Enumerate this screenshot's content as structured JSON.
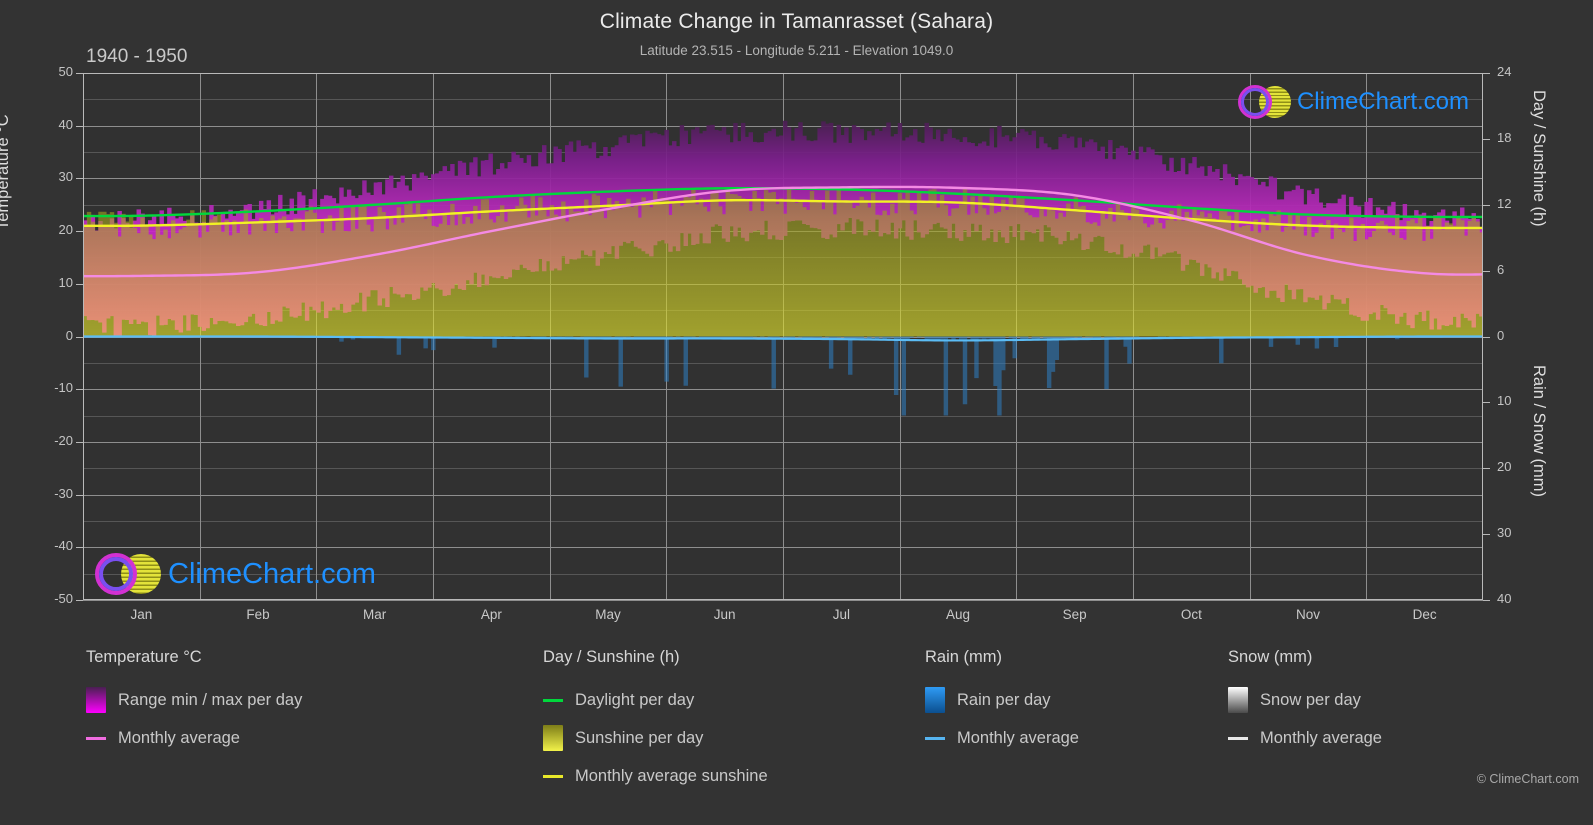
{
  "header": {
    "title": "Climate Change in Tamanrasset (Sahara)",
    "subtitle": "Latitude 23.515 - Longitude 5.211 - Elevation 1049.0",
    "period": "1940 - 1950"
  },
  "axes": {
    "left_label": "Temperature °C",
    "right_label_top": "Day / Sunshine (h)",
    "right_label_bottom": "Rain / Snow (mm)",
    "left_ticks": [
      "50",
      "40",
      "30",
      "20",
      "10",
      "0",
      "-10",
      "-20",
      "-30",
      "-40",
      "-50"
    ],
    "right_ticks_top": [
      "24",
      "18",
      "12",
      "6",
      "0"
    ],
    "right_ticks_bottom": [
      "10",
      "20",
      "30",
      "40"
    ],
    "x_ticks": [
      "Jan",
      "Feb",
      "Mar",
      "Apr",
      "May",
      "Jun",
      "Jul",
      "Aug",
      "Sep",
      "Oct",
      "Nov",
      "Dec"
    ]
  },
  "legend": {
    "temperature": {
      "heading": "Temperature °C",
      "items": [
        {
          "label": "Range min / max per day",
          "marker": "gradient",
          "color": "#ff00ff"
        },
        {
          "label": "Monthly average",
          "marker": "line",
          "color": "#f06ce0"
        }
      ]
    },
    "day_sunshine": {
      "heading": "Day / Sunshine (h)",
      "items": [
        {
          "label": "Daylight per day",
          "marker": "line",
          "color": "#00d83c"
        },
        {
          "label": "Sunshine per day",
          "marker": "gradient",
          "color": "#eded32"
        },
        {
          "label": "Monthly average sunshine",
          "marker": "line",
          "color": "#e8e82a"
        }
      ]
    },
    "rain": {
      "heading": "Rain (mm)",
      "items": [
        {
          "label": "Rain per day",
          "marker": "gradient",
          "color": "#1e90ff"
        },
        {
          "label": "Monthly average",
          "marker": "line",
          "color": "#56b4f0"
        }
      ]
    },
    "snow": {
      "heading": "Snow (mm)",
      "items": [
        {
          "label": "Snow per day",
          "marker": "gradient",
          "color": "#ffffff"
        },
        {
          "label": "Monthly average",
          "marker": "line",
          "color": "#e8e8e8"
        }
      ]
    }
  },
  "branding": {
    "name": "ClimeChart.com",
    "copyright": "© ClimeChart.com"
  },
  "chart_data": {
    "type": "area",
    "title": "Climate Change in Tamanrasset (Sahara)",
    "subtitle": "Latitude 23.515 - Longitude 5.211 - Elevation 1049.0",
    "period": "1940 - 1950",
    "xlabel": "",
    "ylabel": "Temperature °C",
    "ylabel_right_top": "Day / Sunshine (h)",
    "ylabel_right_bottom": "Rain / Snow (mm)",
    "ylim": [
      -50,
      50
    ],
    "ylim_right_top": [
      0,
      24
    ],
    "ylim_right_bottom": [
      0,
      40
    ],
    "grid": true,
    "legend_position": "below",
    "categories": [
      "Jan",
      "Feb",
      "Mar",
      "Apr",
      "May",
      "Jun",
      "Jul",
      "Aug",
      "Sep",
      "Oct",
      "Nov",
      "Dec"
    ],
    "series": [
      {
        "name": "Monthly average temperature",
        "unit": "°C",
        "color": "#f06ce0",
        "values": [
          11.5,
          12.2,
          15.5,
          20.0,
          24.2,
          27.6,
          28.3,
          28.2,
          26.8,
          22.0,
          15.4,
          12.0
        ]
      },
      {
        "name": "Daily maximum temperature (range top)",
        "unit": "°C",
        "color": "#b02ab0",
        "values": [
          22.0,
          24.0,
          28.0,
          32.5,
          36.0,
          38.5,
          38.5,
          38.0,
          36.5,
          32.0,
          26.5,
          22.5
        ]
      },
      {
        "name": "Daily minimum temperature (range bottom)",
        "unit": "°C",
        "color": "#ff00ff",
        "values": [
          2.0,
          3.5,
          7.0,
          11.5,
          15.5,
          19.5,
          20.5,
          20.0,
          18.5,
          13.5,
          7.0,
          3.0
        ]
      },
      {
        "name": "Daylight per day",
        "unit": "h",
        "color": "#00d83c",
        "values": [
          11.0,
          11.4,
          12.0,
          12.7,
          13.2,
          13.5,
          13.4,
          13.0,
          12.4,
          11.7,
          11.1,
          10.9
        ]
      },
      {
        "name": "Monthly average sunshine",
        "unit": "h",
        "color": "#e8e82a",
        "values": [
          10.1,
          10.4,
          10.8,
          11.4,
          11.9,
          12.4,
          12.3,
          12.2,
          11.5,
          10.7,
          10.1,
          9.9
        ]
      },
      {
        "name": "Monthly average rain",
        "unit": "mm",
        "color": "#56b4f0",
        "values": [
          0.0,
          0.0,
          0.1,
          0.2,
          0.3,
          0.3,
          0.4,
          0.6,
          0.4,
          0.2,
          0.1,
          0.0
        ]
      },
      {
        "name": "Monthly average snow",
        "unit": "mm",
        "color": "#e8e8e8",
        "values": [
          0.0,
          0.0,
          0.0,
          0.0,
          0.0,
          0.0,
          0.0,
          0.0,
          0.0,
          0.0,
          0.0,
          0.0
        ]
      }
    ]
  }
}
